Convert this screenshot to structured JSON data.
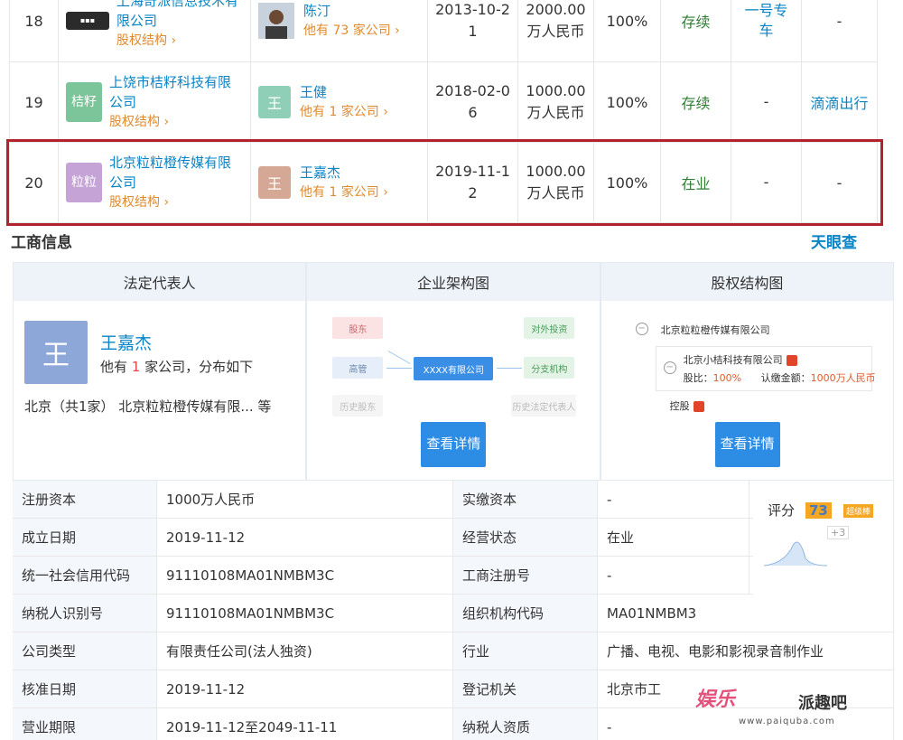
{
  "investments": [
    {
      "index": "18",
      "company": "上海奇派信息技术有限公司",
      "company_line1": "上海奇派信息技术有",
      "company_line2": "限公司",
      "logo_text": "",
      "logo_color": "#333333",
      "equity_link": "股权结构 ›",
      "person": "陈汀",
      "person_more": "他有 73 家公司 ›",
      "avatar_text": "",
      "avatar_color": "#8d6e58",
      "date_line1": "2013-10-2",
      "date_line2": "1",
      "capital_line1": "2000.00",
      "capital_line2": "万人民币",
      "ratio": "100%",
      "status": "存续",
      "brand_line1": "一号专",
      "brand_line2": "车",
      "product": "-"
    },
    {
      "index": "19",
      "company_line1": "上饶市桔籽科技有限",
      "company_line2": "公司",
      "logo_text": "桔籽",
      "logo_color": "#7cc49a",
      "equity_link": "股权结构 ›",
      "person": "王健",
      "person_more": "他有 1 家公司 ›",
      "avatar_text": "王",
      "avatar_color": "#8fcfb8",
      "date_line1": "2018-02-0",
      "date_line2": "6",
      "capital_line1": "1000.00",
      "capital_line2": "万人民币",
      "ratio": "100%",
      "status": "存续",
      "brand_line1": "-",
      "brand_line2": "",
      "product": "滴滴出行"
    },
    {
      "index": "20",
      "company_line1": "北京粒粒橙传媒有限",
      "company_line2": "公司",
      "logo_text": "粒粒",
      "logo_color": "#c5a3d6",
      "equity_link": "股权结构 ›",
      "person": "王嘉杰",
      "person_more": "他有 1 家公司 ›",
      "avatar_text": "王",
      "avatar_color": "#d4a895",
      "date_line1": "2019-11-1",
      "date_line2": "2",
      "capital_line1": "1000.00",
      "capital_line2": "万人民币",
      "ratio": "100%",
      "status": "在业",
      "brand_line1": "-",
      "brand_line2": "",
      "product": "-"
    }
  ],
  "section": {
    "title": "工商信息",
    "logo": "天眼查"
  },
  "panels": {
    "legal": {
      "header": "法定代表人",
      "avatar": "王",
      "name": "王嘉杰",
      "desc_prefix": "他有 ",
      "desc_num": "1",
      "desc_suffix": " 家公司，分布如下",
      "location": "北京（共1家）  北京粒粒橙传媒有限... 等"
    },
    "org": {
      "header": "企业架构图",
      "boxes": {
        "shareholder": "股东",
        "executive": "高管",
        "former": "历史股东",
        "center": "XXXX有限公司",
        "investment": "对外投资",
        "branch": "分支机构",
        "former_rep": "历史法定代表人"
      },
      "button": "查看详情"
    },
    "equity": {
      "header": "股权结构图",
      "root": "北京粒粒橙传媒有限公司",
      "holder": "北京小桔科技有限公司",
      "ratio_label": "股比：",
      "ratio_value": "100%",
      "amount_label": "认缴金额：",
      "amount_value": "1000万人民币",
      "control": "控股",
      "button": "查看详情"
    }
  },
  "info": {
    "rows": [
      {
        "k1": "注册资本",
        "v1": "1000万人民币",
        "k2": "实缴资本",
        "v2": "-"
      },
      {
        "k1": "成立日期",
        "v1": "2019-11-12",
        "k2": "经营状态",
        "v2": "在业"
      },
      {
        "k1": "统一社会信用代码",
        "v1": "91110108MA01NMBM3C",
        "k2": "工商注册号",
        "v2": "-"
      },
      {
        "k1": "纳税人识别号",
        "v1": "91110108MA01NMBM3C",
        "k2": "组织机构代码",
        "v2": "MA01NMBM3"
      },
      {
        "k1": "公司类型",
        "v1": "有限责任公司(法人独资)",
        "k2": "行业",
        "v2": "广播、电视、电影和影视录音制作业"
      },
      {
        "k1": "核准日期",
        "v1": "2019-11-12",
        "k2": "登记机关",
        "v2": "北京市工"
      },
      {
        "k1": "营业期限",
        "v1": "2019-11-12至2049-11-11",
        "k2": "纳税人资质",
        "v2": "-"
      }
    ],
    "score_label": "评分",
    "score": "73",
    "score_tag": "超级棒",
    "score_plus": "+3"
  },
  "watermark": {
    "brand": "娱乐",
    "name": "派趣吧",
    "url": "www.paiquba.com"
  }
}
